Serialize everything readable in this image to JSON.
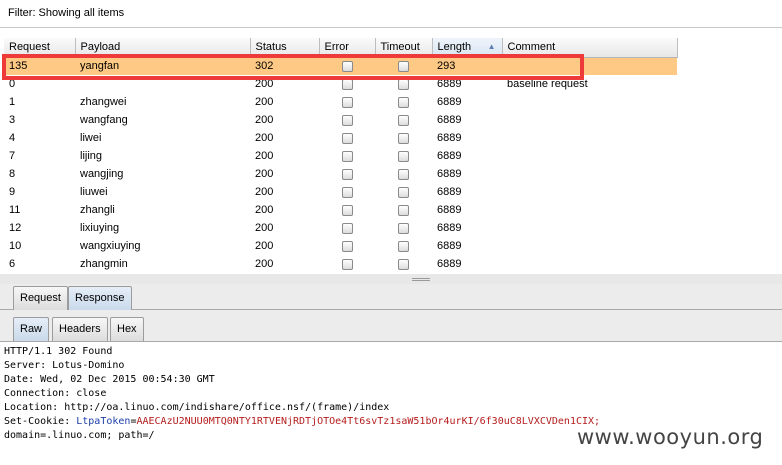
{
  "filter": {
    "label": "Filter: Showing all items"
  },
  "table": {
    "columns": [
      "Request",
      "Payload",
      "Status",
      "Error",
      "Timeout",
      "Length",
      "Comment"
    ],
    "sorted_column": "Length",
    "rows": [
      {
        "request": "135",
        "payload": "yangfan",
        "status": "302",
        "length": "293",
        "comment": "",
        "selected": true
      },
      {
        "request": "0",
        "payload": "",
        "status": "200",
        "length": "6889",
        "comment": "baseline request",
        "selected": false
      },
      {
        "request": "1",
        "payload": "zhangwei",
        "status": "200",
        "length": "6889",
        "comment": "",
        "selected": false
      },
      {
        "request": "3",
        "payload": "wangfang",
        "status": "200",
        "length": "6889",
        "comment": "",
        "selected": false
      },
      {
        "request": "4",
        "payload": "liwei",
        "status": "200",
        "length": "6889",
        "comment": "",
        "selected": false
      },
      {
        "request": "7",
        "payload": "lijing",
        "status": "200",
        "length": "6889",
        "comment": "",
        "selected": false
      },
      {
        "request": "8",
        "payload": "wangjing",
        "status": "200",
        "length": "6889",
        "comment": "",
        "selected": false
      },
      {
        "request": "9",
        "payload": "liuwei",
        "status": "200",
        "length": "6889",
        "comment": "",
        "selected": false
      },
      {
        "request": "11",
        "payload": "zhangli",
        "status": "200",
        "length": "6889",
        "comment": "",
        "selected": false
      },
      {
        "request": "12",
        "payload": "lixiuying",
        "status": "200",
        "length": "6889",
        "comment": "",
        "selected": false
      },
      {
        "request": "10",
        "payload": "wangxiuying",
        "status": "200",
        "length": "6889",
        "comment": "",
        "selected": false
      },
      {
        "request": "6",
        "payload": "zhangmin",
        "status": "200",
        "length": "6889",
        "comment": "",
        "selected": false
      }
    ]
  },
  "outer_tabs": {
    "request": "Request",
    "response": "Response",
    "active": "Response"
  },
  "inner_tabs": {
    "raw": "Raw",
    "headers": "Headers",
    "hex": "Hex",
    "active": "Raw"
  },
  "response": {
    "line1": "HTTP/1.1 302 Found",
    "line2": "Server: Lotus-Domino",
    "line3": "Date: Wed, 02 Dec 2015 00:54:30 GMT",
    "line4": "Connection: close",
    "line5": "Location: http://oa.linuo.com/indishare/office.nsf/(frame)/index",
    "cookie_prefix": "Set-Cookie: ",
    "cookie_name": "LtpaToken",
    "cookie_eq": "=",
    "cookie_value": "AAECAzU2NUU0MTQ0NTY1RTVENjRDTjOTOe4Tt6svTz1saW51bOr4urKI/6f30uC8LVXCVDen1CIX;",
    "line7": "domain=.linuo.com; path=/"
  },
  "watermark": "www.wooyun.org",
  "colors": {
    "selected_row": "#fdc984",
    "highlight_border": "#ef3a3a",
    "cookie_name": "#1d3ea8",
    "cookie_value": "#b51d1d"
  }
}
